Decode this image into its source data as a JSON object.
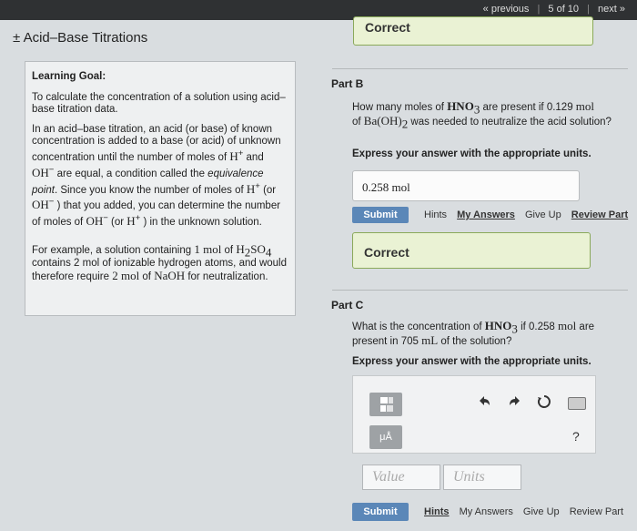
{
  "nav": {
    "previous": "« previous",
    "position": "5 of 10",
    "next": "next »"
  },
  "title": "± Acid–Base Titrations",
  "top_banner": "Correct",
  "learning_goal": {
    "heading": "Learning Goal:",
    "p1": "To calculate the concentration of a solution using acid–base titration data.",
    "p2": {
      "t1": "In an acid–base titration, an acid (or base) of known concentration is added to a base (or acid) of unknown concentration until the number of moles of ",
      "h": "H",
      "t2": " and ",
      "oh": "OH",
      "t3": " are equal, a condition called the ",
      "eq": "equivalence point",
      "t4": ". Since you know the number of moles of ",
      "h2": "H",
      "t5": " (or ",
      "oh2": "OH",
      "t6": " ) that you added, you can determine the number of moles of ",
      "oh3": "OH",
      "t7": " (or ",
      "h3": "H",
      "t8": " ) in the unknown solution.",
      "plus": "+",
      "minus": "−"
    },
    "p3": {
      "t1": "For example, a solution containing ",
      "m1": "1 mol",
      "t2": " of ",
      "h2so4": "H",
      "sub2": "2",
      "so": "SO",
      "sub4": "4",
      "t3": " contains 2 mol of ionizable hydrogen atoms, and would therefore require ",
      "m2": "2 mol",
      "t4": " of ",
      "naoh": "NaOH",
      "t5": " for neutralization."
    }
  },
  "part_b": {
    "label": "Part B",
    "q1": "How many moles of ",
    "hno3": "HNO",
    "sub3": "3",
    "q2": " are present if 0.129 ",
    "mol": "mol",
    "q3": "of ",
    "baoh": "Ba(OH)",
    "sub2": "2",
    "q4": " was needed to neutralize the acid solution?",
    "instruction": "Express your answer with the appropriate units.",
    "answer": "0.258 mol",
    "submit": "Submit",
    "hints": "Hints",
    "my_answers": "My Answers",
    "give_up": "Give Up",
    "review": "Review Part",
    "feedback": "Correct"
  },
  "part_c": {
    "label": "Part C",
    "q1": "What is the concentration of ",
    "hno3": "HNO",
    "sub3": "3",
    "q2": " if 0.258 ",
    "mol": "mol",
    "q3": " are present in 705 ",
    "ml": "mL",
    "q4": " of the solution?",
    "instruction": "Express your answer with the appropriate units.",
    "value_placeholder": "Value",
    "units_placeholder": "Units",
    "mu_label": "μÅ",
    "help": "?",
    "submit": "Submit",
    "hints": "Hints",
    "my_answers": "My Answers",
    "give_up": "Give Up",
    "review": "Review Part"
  }
}
